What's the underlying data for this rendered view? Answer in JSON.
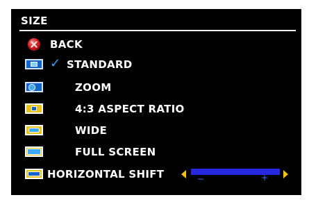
{
  "menu": {
    "title": "SIZE",
    "back_label": "BACK",
    "items": [
      {
        "label": "STANDARD",
        "icon": "standard-screen-icon",
        "selected": true
      },
      {
        "label": "ZOOM",
        "icon": "zoom-screen-icon",
        "selected": false
      },
      {
        "label": "4:3 ASPECT RATIO",
        "icon": "aspect-ratio-icon",
        "selected": false
      },
      {
        "label": "WIDE",
        "icon": "wide-screen-icon",
        "selected": false
      },
      {
        "label": "FULL SCREEN",
        "icon": "full-screen-icon",
        "selected": false
      }
    ],
    "horizontal_shift": {
      "label": "HORIZONTAL SHIFT",
      "minus": "−",
      "plus": "+",
      "level": 1.0
    },
    "check_glyph": "✓"
  },
  "colors": {
    "background": "#000000",
    "text": "#ffffff",
    "check": "#3fa0ff",
    "slider": "#2424d6",
    "arrow": "#f2c20c"
  }
}
